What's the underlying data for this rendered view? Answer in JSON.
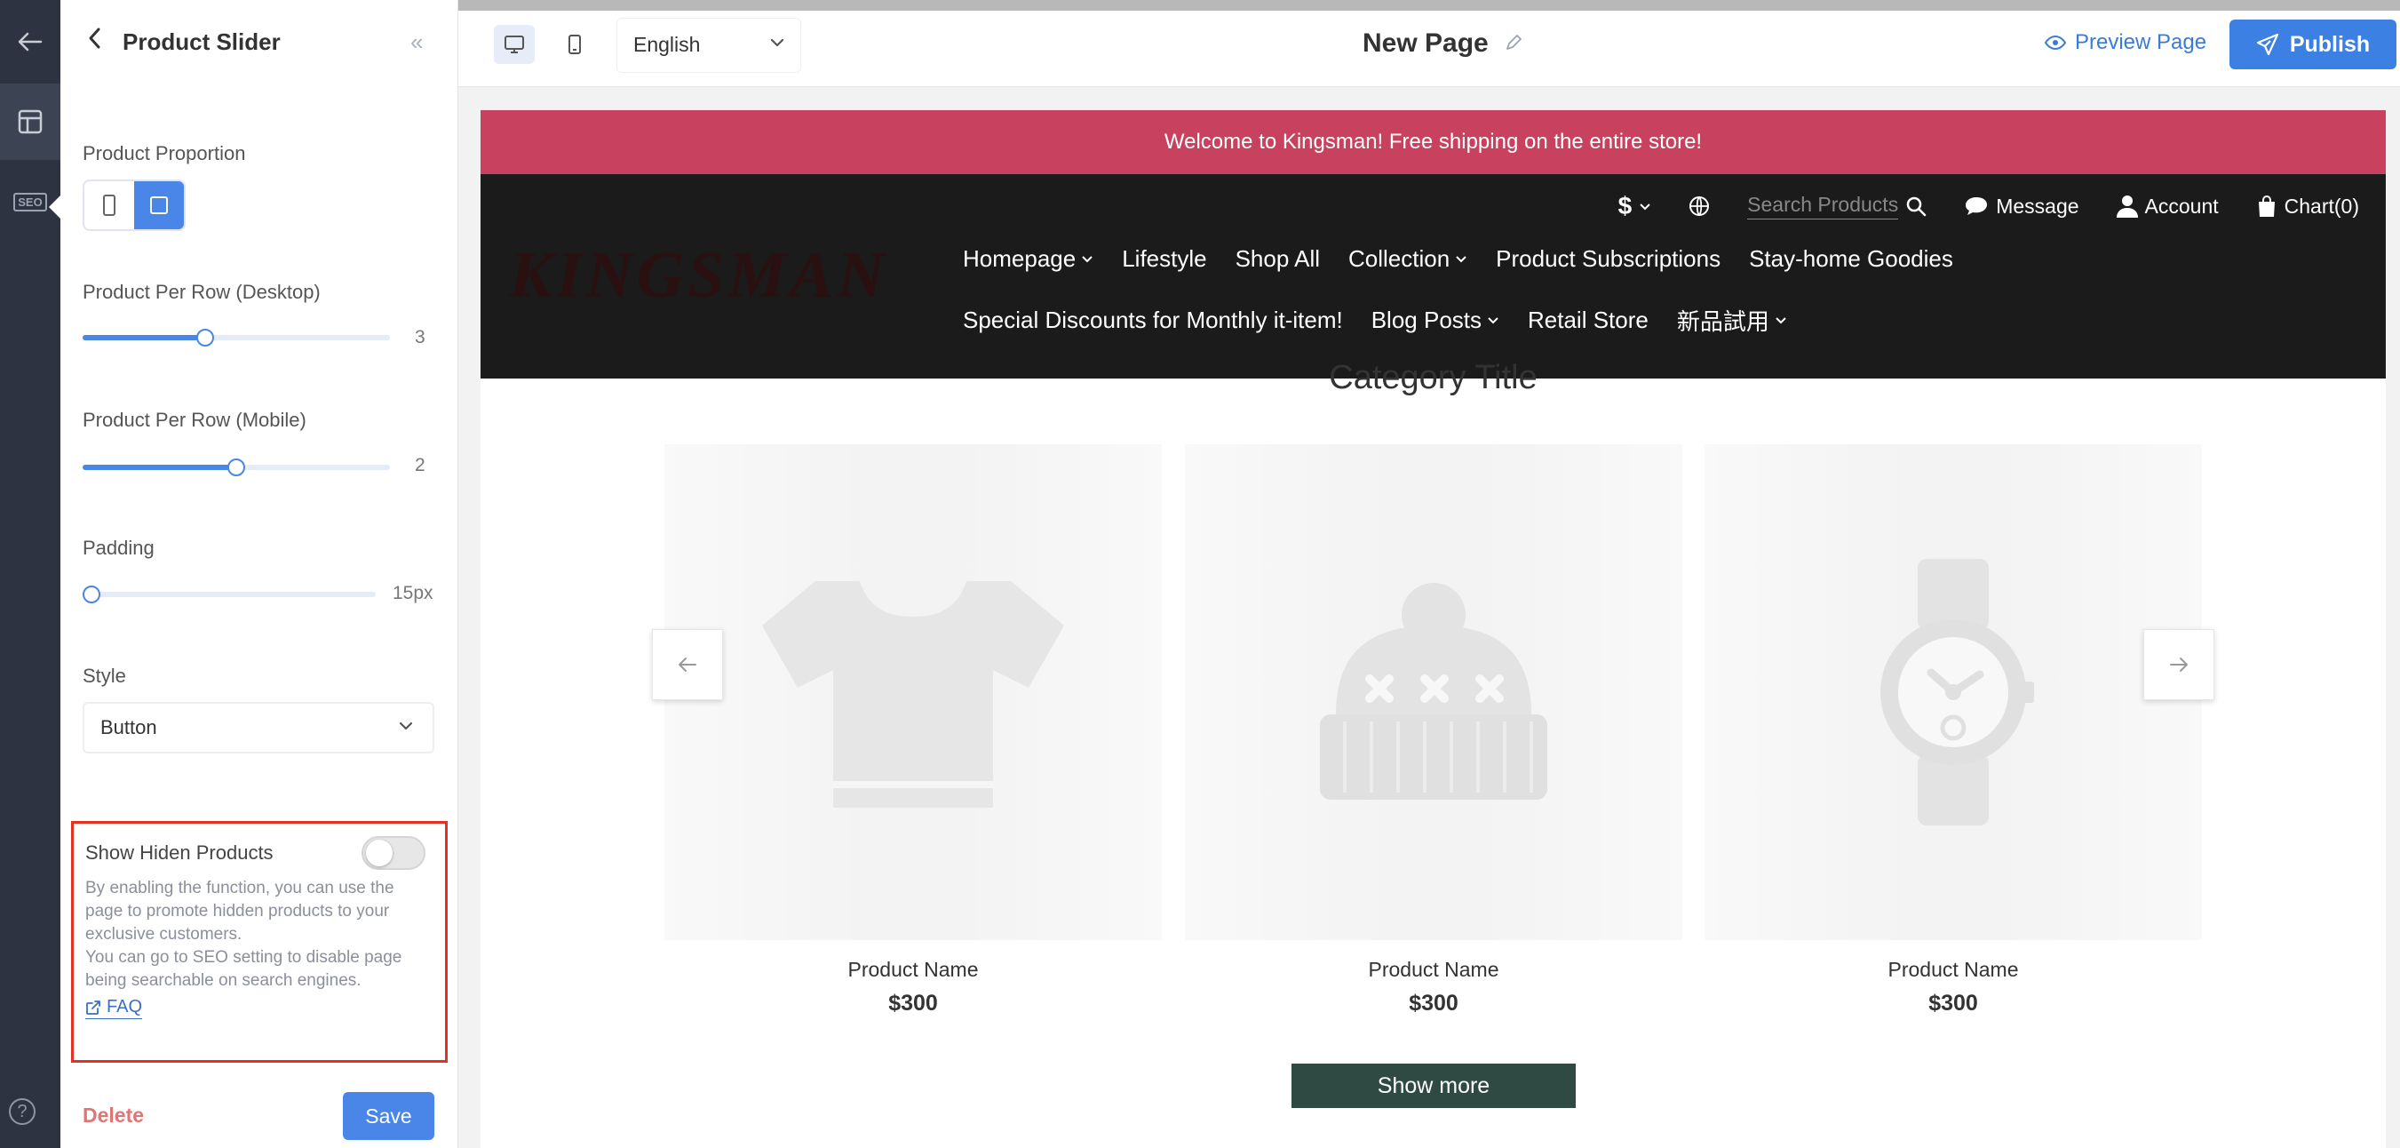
{
  "panel": {
    "title": "Product Slider",
    "product_proportion_label": "Product Proportion",
    "per_row_desktop": {
      "label": "Product Per Row (Desktop)",
      "value": "3",
      "level": 0.4
    },
    "per_row_mobile": {
      "label": "Product Per Row (Mobile)",
      "value": "2",
      "level": 0.5
    },
    "padding": {
      "label": "Padding",
      "value": "15px",
      "level": 0.03
    },
    "style": {
      "label": "Style",
      "selected": "Button"
    },
    "hidden_products": {
      "title": "Show Hiden Products",
      "enabled": false,
      "desc_1": "By enabling the function, you can use the page to promote hidden products to your exclusive customers.",
      "desc_2": "You can go to SEO setting to disable page being searchable on search engines.",
      "faq": "FAQ"
    },
    "delete_label": "Delete",
    "save_label": "Save"
  },
  "rail": {
    "seo_label": "SEO",
    "help_label": "?"
  },
  "topbar": {
    "language": "English",
    "page_title": "New Page",
    "preview_label": "Preview Page",
    "publish_label": "Publish"
  },
  "store": {
    "announcement": "Welcome to Kingsman! Free shipping on the entire store!",
    "logo": "KINGSMAN",
    "util": {
      "currency": "$",
      "search_placeholder": "Search Products",
      "message": "Message",
      "account": "Account",
      "cart": "Chart(0)"
    },
    "nav_row1": [
      "Homepage",
      "Lifestyle",
      "Shop All",
      "Collection",
      "Product Subscriptions",
      "Stay-home Goodies"
    ],
    "nav_row2": [
      "Special Discounts for Monthly it-item!",
      "Blog Posts",
      "Retail Store",
      "新品試用"
    ],
    "category_title": "Category Title",
    "products": [
      {
        "name": "Product Name",
        "price": "$300",
        "icon": "tshirt-icon"
      },
      {
        "name": "Product Name",
        "price": "$300",
        "icon": "beanie-icon"
      },
      {
        "name": "Product Name",
        "price": "$300",
        "icon": "watch-icon"
      }
    ],
    "show_more": "Show more"
  },
  "colors": {
    "accent": "#4a86e8",
    "announcement_bg": "#c8415f",
    "header_bg": "#1b1b1b",
    "show_more_bg": "#2f4a42",
    "highlight_border": "#e53124"
  }
}
